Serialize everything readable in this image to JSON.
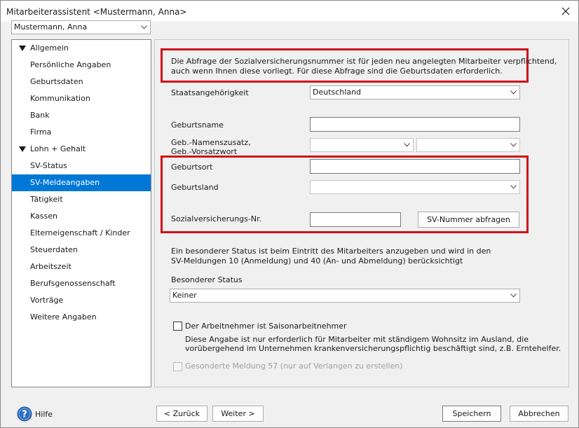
{
  "window": {
    "title": "Mitarbeiterassistent <Mustermann, Anna>",
    "employee_select": "Mustermann, Anna"
  },
  "nav": {
    "groups": [
      {
        "label": "Allgemein",
        "items": [
          "Persönliche Angaben",
          "Geburtsdaten",
          "Kommunikation",
          "Bank",
          "Firma"
        ]
      },
      {
        "label": "Lohn + Gehalt",
        "items": [
          "SV-Status",
          "SV-Meldeangaben",
          "Tätigkeit",
          "Kassen",
          "Elterneigenschaft / Kinder",
          "Steuerdaten",
          "Arbeitszeit",
          "Berufsgenossenschaft",
          "Vorträge",
          "Weitere Angaben"
        ]
      }
    ],
    "selected": "SV-Meldeangaben"
  },
  "form": {
    "info_line1": "Die Abfrage der Sozialversicherungsnummer ist für jeden neu angelegten Mitarbeiter verpflichtend,",
    "info_line2": "auch wenn Ihnen diese vorliegt. Für diese Abfrage sind die Geburtsdaten erforderlich.",
    "staatsangehoerigkeit_label": "Staatsangehörigkeit",
    "staatsangehoerigkeit_value": "Deutschland",
    "geburtsname_label": "Geburtsname",
    "geburtsname_value": "",
    "namenszusatz_label_line1": "Geb.-Namenszusatz,",
    "namenszusatz_label_line2": "Geb.-Vorsatzwort",
    "namenszusatz_value": "",
    "vorsatzwort_value": "",
    "geburtsort_label": "Geburtsort",
    "geburtsort_value": "",
    "geburtsland_label": "Geburtsland",
    "geburtsland_value": "",
    "svnr_label": "Sozialversicherungs-Nr.",
    "svnr_value": "",
    "svnr_button": "SV-Nummer abfragen",
    "status_info_line1": "Ein besonderer Status ist beim Eintritt des Mitarbeiters anzugeben und wird in den",
    "status_info_line2": "SV-Meldungen 10 (Anmeldung) und 40 (An- und Abmeldung) berücksichtigt",
    "besonderer_status_label": "Besonderer Status",
    "besonderer_status_value": "Keiner",
    "saison_label": "Der Arbeitnehmer ist Saisonarbeitnehmer",
    "saison_checked": false,
    "saison_hint_line1": "Diese Angabe ist nur erforderlich für Mitarbeiter mit ständigem Wohnsitz im Ausland, die",
    "saison_hint_line2": "vorübergehend im Unternehmen krankenversicherungspflichtig beschäftigt sind, z.B. Erntehelfer.",
    "meldung57_label": "Gesonderte Meldung 57 (nur auf Verlangen zu erstellen)",
    "meldung57_checked": false,
    "meldung57_enabled": false
  },
  "footer": {
    "help": "Hilfe",
    "back": "< Zurück",
    "next": "Weiter >",
    "save": "Speichern",
    "cancel": "Abbrechen"
  },
  "colors": {
    "selection": "#0078d7",
    "highlight_frame": "#d0101a",
    "help_icon": "#2d6fc0"
  },
  "icons": [
    "close-icon",
    "chevron-down-icon",
    "triangle-down-icon",
    "help-icon"
  ]
}
